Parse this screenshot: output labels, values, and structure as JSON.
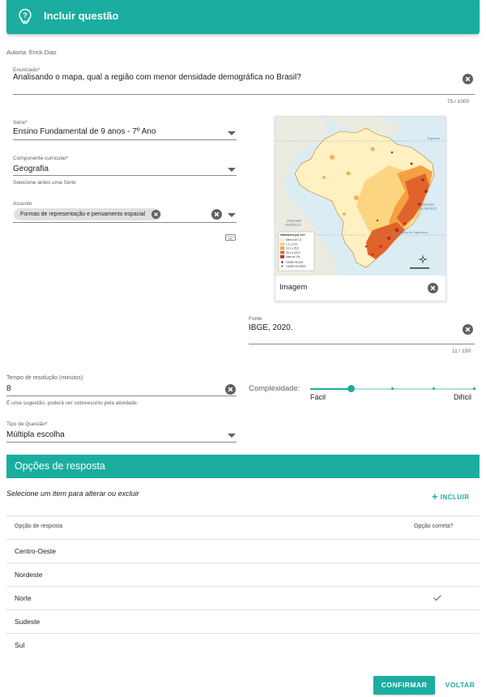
{
  "header": {
    "title": "Incluir questão",
    "icon": "lightbulb-question-icon",
    "color": "#1aada0"
  },
  "author": "Autoria: Erick Dias",
  "statement": {
    "label": "Enunciado*",
    "value": "Analisando o mapa, qual a região com menor densidade demográfica no Brasil?",
    "counter": "75 / 1000"
  },
  "grade": {
    "label": "Série*",
    "value": "Ensino Fundamental de 9 anos - 7º Ano"
  },
  "component": {
    "label": "Componente curricular*",
    "value": "Geografia",
    "hint": "Selecione antes uma Série"
  },
  "subject": {
    "label": "Assunto",
    "chip": "Formas de representação e pensamento espacial"
  },
  "image": {
    "caption": "Imagem",
    "map": {
      "legend_title": "Habitantes por km²",
      "legend_items": [
        "Menos de 1,0",
        "1,1 a 10,0",
        "10,1 a 25,0",
        "25,1 a 100,0",
        "Mais de 100"
      ],
      "legend_colors": [
        "#fff3c4",
        "#fcd27a",
        "#f5a142",
        "#e0642a",
        "#b3301c"
      ],
      "legend_markers": [
        "Capital de país",
        "Capital de estado"
      ],
      "ocean_pacific": [
        "OCEANO",
        "PACÍFICO"
      ],
      "ocean_atlantic": [
        "OCEANO",
        "ATLÂNTICO"
      ],
      "equator": "Equador",
      "tropic": "Trópico de Capricórnio"
    }
  },
  "source": {
    "label": "Fonte",
    "value": "IBGE, 2020.",
    "counter": "11 / 150"
  },
  "time": {
    "label": "Tempo de resolução (minutos)",
    "value": "8",
    "hint": "É uma sugestão, poderá ser sobreescrito pela atividade."
  },
  "complexity": {
    "label": "Complexidade:",
    "min_label": "Fácil",
    "max_label": "Difícil",
    "level": 0.25
  },
  "question_type": {
    "label": "Tipo de Questão*",
    "value": "Múltipla escolha"
  },
  "options_section": {
    "title": "Opções de resposta",
    "instruction": "Selecione um item para alterar ou excluir",
    "add_label": "INCLUIR",
    "col_option": "Opção de resposta",
    "col_correct": "Opção correta?",
    "rows": [
      {
        "label": "Centro-Oeste",
        "correct": false
      },
      {
        "label": "Nordeste",
        "correct": false
      },
      {
        "label": "Norte",
        "correct": true
      },
      {
        "label": "Sudeste",
        "correct": false
      },
      {
        "label": "Sul",
        "correct": false
      }
    ]
  },
  "actions": {
    "confirm": "CONFIRMAR",
    "back": "VOLTAR"
  }
}
